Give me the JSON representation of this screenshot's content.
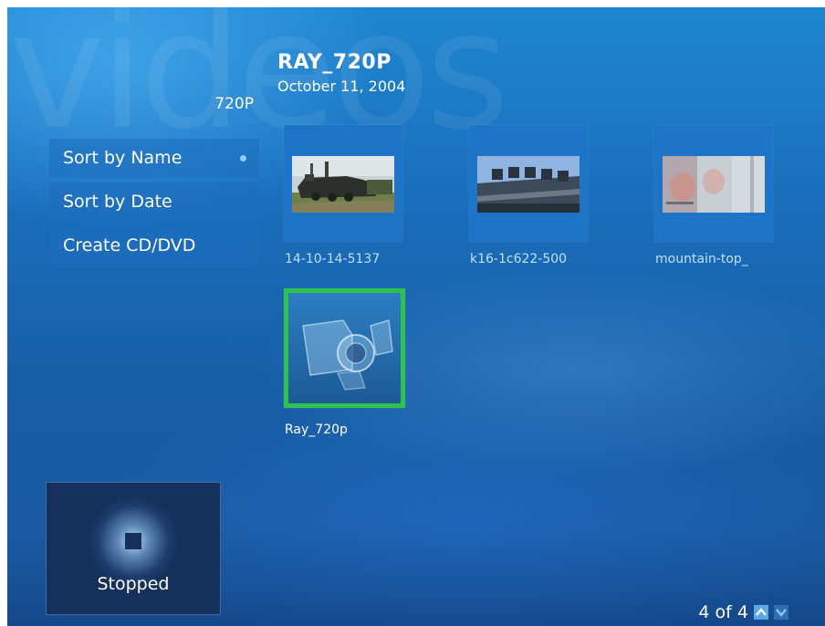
{
  "background": {
    "watermark": "videos"
  },
  "header": {
    "subtitle": "720P",
    "title": "RAY_720P",
    "date": "October 11, 2004"
  },
  "menu": {
    "items": [
      {
        "label": "Sort by Name",
        "selected": true
      },
      {
        "label": "Sort by Date"
      },
      {
        "label": "Create CD/DVD"
      }
    ]
  },
  "grid": {
    "items": [
      {
        "caption": "14-10-14-5137",
        "thumb": "steam-train-thumbnail"
      },
      {
        "caption": "k16-1c622-500",
        "thumb": "building-sign-thumbnail"
      },
      {
        "caption": "mountain-top_",
        "thumb": "hazy-scene-thumbnail"
      },
      {
        "caption": "Ray_720p",
        "thumb": "video-camera-icon",
        "focused": true
      }
    ]
  },
  "player": {
    "status": "Stopped",
    "icon": "stop-icon"
  },
  "pager": {
    "text": "4 of 4"
  },
  "colors": {
    "focus_border": "#2ec24f",
    "tile": "#1e74c6",
    "background": "#1b6fbc"
  }
}
